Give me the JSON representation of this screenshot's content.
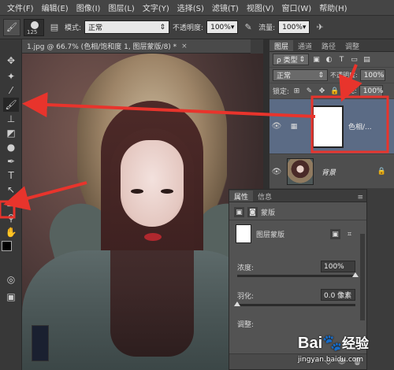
{
  "menu": [
    "文件(F)",
    "编辑(E)",
    "图像(I)",
    "图层(L)",
    "文字(Y)",
    "选择(S)",
    "滤镜(T)",
    "视图(V)",
    "窗口(W)",
    "帮助(H)"
  ],
  "options": {
    "brush_size": "125",
    "mode_label": "模式:",
    "mode_value": "正常",
    "opacity_label": "不透明度:",
    "opacity_value": "100%",
    "flow_label": "流量:",
    "flow_value": "100%"
  },
  "document": {
    "tab_title": "1.jpg @ 66.7% (色相/饱和度 1, 图层蒙版/8) *",
    "close": "×"
  },
  "layers_panel": {
    "tabs": [
      "图层",
      "通道",
      "路径",
      "调整"
    ],
    "filter_label": "ρ 类型",
    "blend_mode": "正常",
    "opacity_label": "不透明度:",
    "opacity_value": "100%",
    "lock_label": "锁定:",
    "fill_label": "填充:",
    "fill_value": "100%",
    "layers": [
      {
        "name": "色相/..."
      },
      {
        "name": "背景"
      }
    ]
  },
  "properties_panel": {
    "tabs": [
      "属性",
      "信息"
    ],
    "mode_label": "蒙版",
    "mask_label": "图层蒙版",
    "density_label": "浓度:",
    "density_value": "100%",
    "density_level": 1.0,
    "feather_label": "羽化:",
    "feather_value": "0.0 像素",
    "feather_level": 0.0,
    "refine_label": "调整:"
  },
  "watermark": {
    "brand": "Bai",
    "brand_suffix": "经验",
    "url": "jingyan.baidu.com"
  },
  "annotation_color": "#e8342c",
  "accent_color": "#506080"
}
